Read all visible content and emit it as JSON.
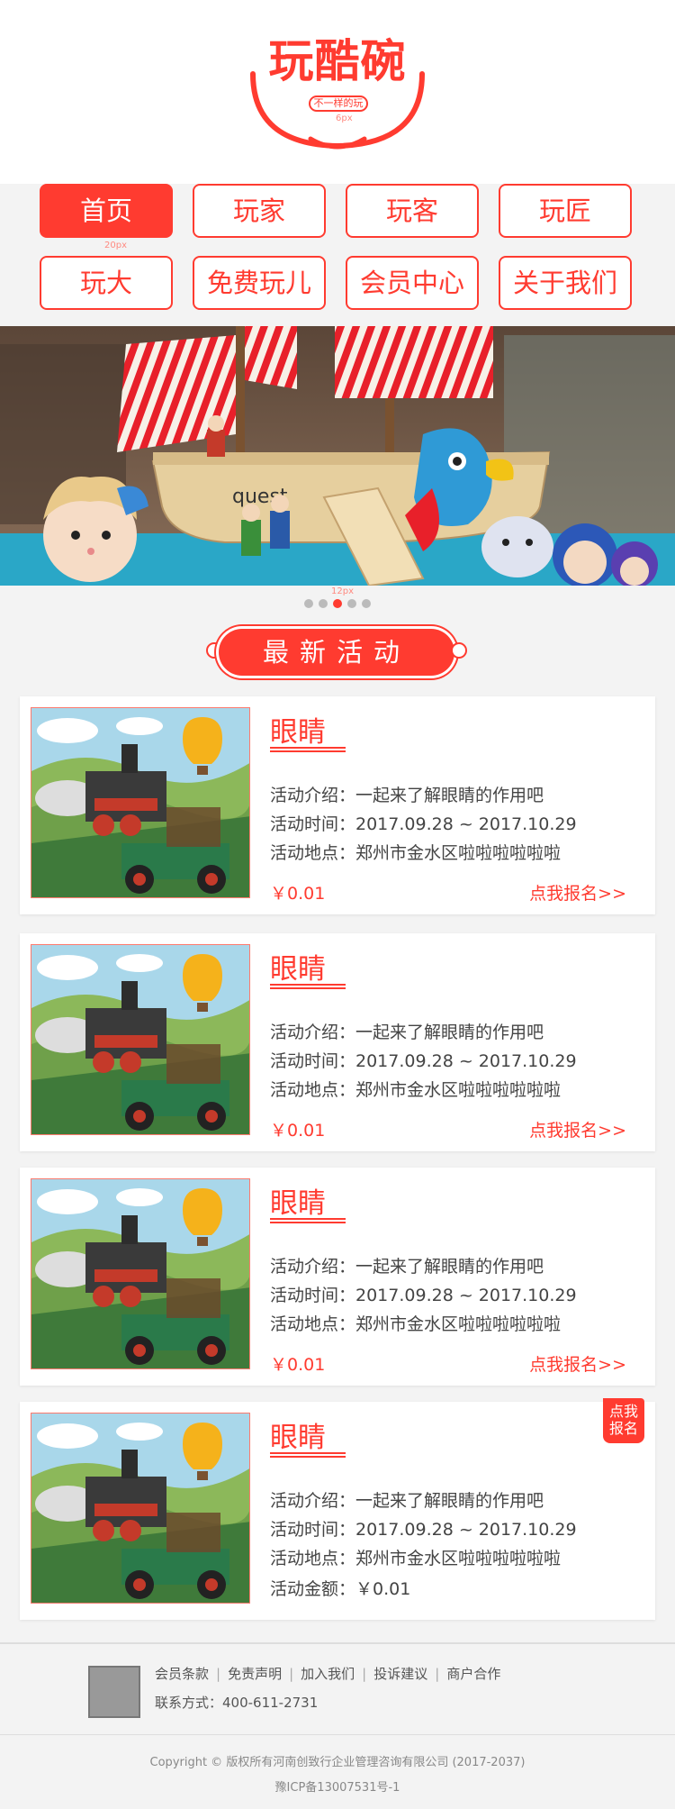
{
  "header": {
    "logo_text": "玩酷碗",
    "logo_slogan": "不一样的玩",
    "logo_anno": "6px"
  },
  "nav": {
    "items": [
      {
        "label": "首页",
        "active": true
      },
      {
        "label": "玩家"
      },
      {
        "label": "玩客"
      },
      {
        "label": "玩匠"
      },
      {
        "label": "玩大"
      },
      {
        "label": "免费玩儿"
      },
      {
        "label": "会员中心"
      },
      {
        "label": "关于我们"
      }
    ],
    "anno_gap": "20px"
  },
  "banner": {
    "anno": "12px",
    "dots_count": 5,
    "active_dot": 3
  },
  "section": {
    "title": "最新活动"
  },
  "cards": [
    {
      "title": "眼睛",
      "intro": "活动介绍：一起来了解眼睛的作用吧",
      "time": "活动时间：2017.09.28 ~ 2017.10.29",
      "place": "活动地点：郑州市金水区啦啦啦啦啦啦",
      "price": "￥0.01",
      "signup": "点我报名>>"
    },
    {
      "title": "眼睛",
      "intro": "活动介绍：一起来了解眼睛的作用吧",
      "time": "活动时间：2017.09.28 ~ 2017.10.29",
      "place": "活动地点：郑州市金水区啦啦啦啦啦啦",
      "price": "￥0.01",
      "signup": "点我报名>>"
    },
    {
      "title": "眼睛",
      "intro": "活动介绍：一起来了解眼睛的作用吧",
      "time": "活动时间：2017.09.28 ~ 2017.10.29",
      "place": "活动地点：郑州市金水区啦啦啦啦啦啦",
      "price": "￥0.01",
      "signup": "点我报名>>"
    },
    {
      "title": "眼睛",
      "intro": "活动介绍：一起来了解眼睛的作用吧",
      "time": "活动时间：2017.09.28 ~ 2017.10.29",
      "place": "活动地点：郑州市金水区啦啦啦啦啦啦",
      "amount": "活动金额：￥0.01",
      "badge_line1": "点我",
      "badge_line2": "报名"
    }
  ],
  "footer": {
    "links": [
      "会员条款",
      "免责声明",
      "加入我们",
      "投诉建议",
      "商户合作"
    ],
    "contact": "联系方式：400-611-2731",
    "copyright": "Copyright © 版权所有河南创致行企业管理咨询有限公司 (2017-2037)",
    "icp": "豫ICP备13007531号-1"
  },
  "colors": {
    "accent": "#ff3b30",
    "background": "#f3f3f3"
  }
}
